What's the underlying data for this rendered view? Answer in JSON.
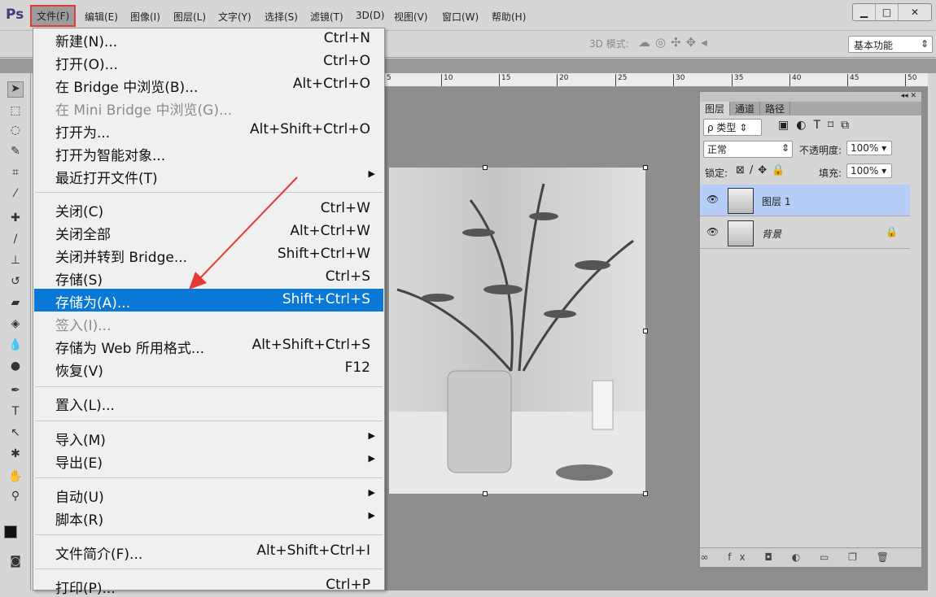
{
  "app": {
    "logo": "Ps"
  },
  "menubar": [
    "文件(F)",
    "编辑(E)",
    "图像(I)",
    "图层(L)",
    "文字(Y)",
    "选择(S)",
    "滤镜(T)",
    "3D(D)",
    "视图(V)",
    "窗口(W)",
    "帮助(H)"
  ],
  "window_controls": {
    "minimize": "▁",
    "maximize": "□",
    "close": "✕"
  },
  "options": {
    "mode3d": "3D 模式:",
    "workspace": "基本功能"
  },
  "ruler": [
    "5",
    "10",
    "15",
    "20",
    "25",
    "30",
    "35",
    "40",
    "45",
    "50"
  ],
  "file_menu": [
    {
      "label": "新建(N)...",
      "shortcut": "Ctrl+N"
    },
    {
      "label": "打开(O)...",
      "shortcut": "Ctrl+O"
    },
    {
      "label": "在 Bridge 中浏览(B)...",
      "shortcut": "Alt+Ctrl+O"
    },
    {
      "label": "在 Mini Bridge 中浏览(G)...",
      "shortcut": "",
      "disabled": true
    },
    {
      "label": "打开为...",
      "shortcut": "Alt+Shift+Ctrl+O"
    },
    {
      "label": "打开为智能对象...",
      "shortcut": ""
    },
    {
      "label": "最近打开文件(T)",
      "shortcut": "",
      "submenu": true
    },
    {
      "label": "关闭(C)",
      "shortcut": "Ctrl+W"
    },
    {
      "label": "关闭全部",
      "shortcut": "Alt+Ctrl+W"
    },
    {
      "label": "关闭并转到 Bridge...",
      "shortcut": "Shift+Ctrl+W"
    },
    {
      "label": "存储(S)",
      "shortcut": "Ctrl+S"
    },
    {
      "label": "存储为(A)...",
      "shortcut": "Shift+Ctrl+S",
      "highlighted": true
    },
    {
      "label": "签入(I)...",
      "shortcut": "",
      "disabled": true
    },
    {
      "label": "存储为 Web 所用格式...",
      "shortcut": "Alt+Shift+Ctrl+S"
    },
    {
      "label": "恢复(V)",
      "shortcut": "F12"
    },
    {
      "label": "置入(L)...",
      "shortcut": ""
    },
    {
      "label": "导入(M)",
      "shortcut": "",
      "submenu": true
    },
    {
      "label": "导出(E)",
      "shortcut": "",
      "submenu": true
    },
    {
      "label": "自动(U)",
      "shortcut": "",
      "submenu": true
    },
    {
      "label": "脚本(R)",
      "shortcut": "",
      "submenu": true
    },
    {
      "label": "文件简介(F)...",
      "shortcut": "Alt+Shift+Ctrl+I"
    },
    {
      "label": "打印(P)...",
      "shortcut": "Ctrl+P"
    }
  ],
  "layers_panel": {
    "tabs": [
      "图层",
      "通道",
      "路径"
    ],
    "filter": "ρ 类型",
    "blend_mode": "正常",
    "opacity_label": "不透明度:",
    "opacity": "100%",
    "lock_label": "锁定:",
    "fill_label": "填充:",
    "fill": "100%",
    "layers": [
      {
        "name": "图层 1",
        "selected": true
      },
      {
        "name": "背景",
        "locked": true
      }
    ]
  },
  "colors": {
    "highlight": "#0a78d7",
    "annotation": "#e53935",
    "selected_layer": "#b5cdf7"
  }
}
